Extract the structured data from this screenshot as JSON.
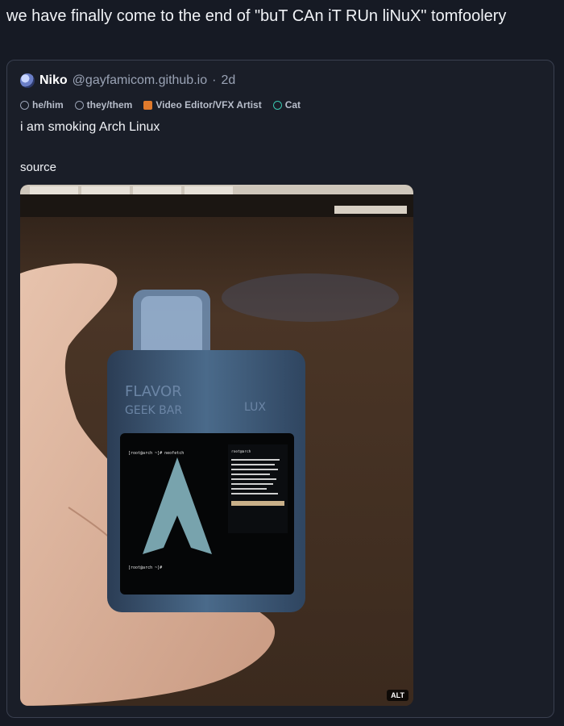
{
  "post": {
    "text": "we have finally come to the end of \"buT CAn iT RUn liNuX\" tomfoolery"
  },
  "quote": {
    "display_name": "Niko",
    "handle": "@gayfamicom.github.io",
    "separator": "·",
    "age": "2d",
    "tags": [
      {
        "icon": "gear-icon",
        "label": "he/him"
      },
      {
        "icon": "gear-icon",
        "label": "they/them"
      },
      {
        "icon": "fox-icon",
        "label": "Video Editor/VFX Artist"
      },
      {
        "icon": "cat-icon",
        "label": "Cat"
      }
    ],
    "body": "i am smoking Arch Linux",
    "link": "source"
  },
  "media": {
    "alt_badge": "ALT",
    "device_brand": "GEEK BAR",
    "device_flavor": "FLAVOR",
    "device_side": "LUX",
    "terminal_prompt_top": "[root@arch ~]# neofetch",
    "terminal_prompt_bottom": "[root@arch ~]# ",
    "info_header": "root@arch"
  },
  "colors": {
    "background": "#161a24",
    "card_border": "#3a4050",
    "handle": "#9aa3b5"
  }
}
